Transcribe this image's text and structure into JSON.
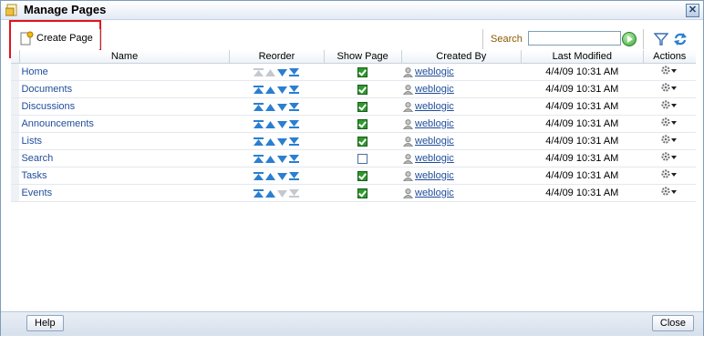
{
  "window": {
    "title": "Manage Pages"
  },
  "toolbar": {
    "create_label": "Create Page",
    "search_label": "Search",
    "search_value": ""
  },
  "table": {
    "columns": [
      "Name",
      "Reorder",
      "Show Page",
      "Created By",
      "Last Modified",
      "Actions"
    ],
    "rows": [
      {
        "name": "Home",
        "show": true,
        "created_by": "weblogic",
        "modified": "4/4/09 10:31 AM",
        "can_up": false,
        "can_down": true
      },
      {
        "name": "Documents",
        "show": true,
        "created_by": "weblogic",
        "modified": "4/4/09 10:31 AM",
        "can_up": true,
        "can_down": true
      },
      {
        "name": "Discussions",
        "show": true,
        "created_by": "weblogic",
        "modified": "4/4/09 10:31 AM",
        "can_up": true,
        "can_down": true
      },
      {
        "name": "Announcements",
        "show": true,
        "created_by": "weblogic",
        "modified": "4/4/09 10:31 AM",
        "can_up": true,
        "can_down": true
      },
      {
        "name": "Lists",
        "show": true,
        "created_by": "weblogic",
        "modified": "4/4/09 10:31 AM",
        "can_up": true,
        "can_down": true
      },
      {
        "name": "Search",
        "show": false,
        "created_by": "weblogic",
        "modified": "4/4/09 10:31 AM",
        "can_up": true,
        "can_down": true
      },
      {
        "name": "Tasks",
        "show": true,
        "created_by": "weblogic",
        "modified": "4/4/09 10:31 AM",
        "can_up": true,
        "can_down": true
      },
      {
        "name": "Events",
        "show": true,
        "created_by": "weblogic",
        "modified": "4/4/09 10:31 AM",
        "can_up": true,
        "can_down": false
      }
    ]
  },
  "footer": {
    "help_label": "Help",
    "close_label": "Close"
  },
  "colors": {
    "link": "#1f4d9a",
    "accent_blue": "#2a7fd1",
    "highlight_red": "#e0141e"
  }
}
